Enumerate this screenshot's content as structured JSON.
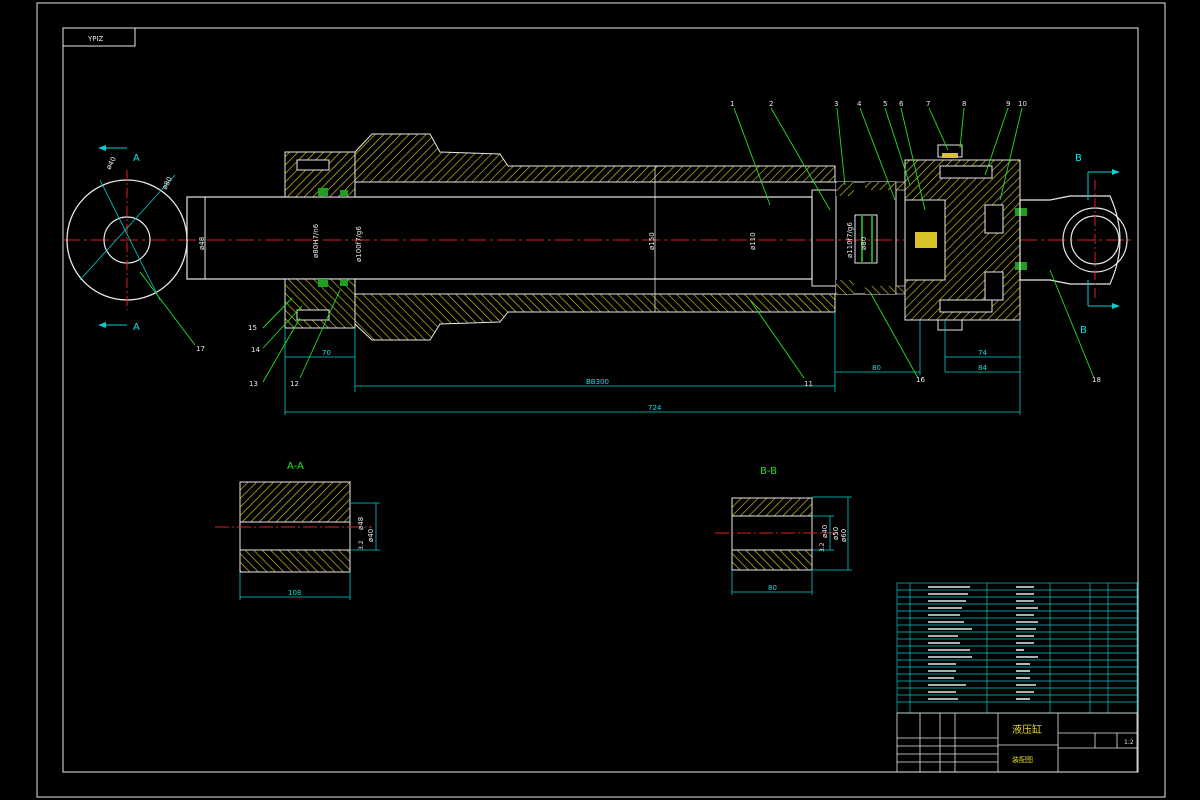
{
  "drawing": {
    "corner_label": "YPIZ",
    "section_aa_title": "A-A",
    "section_bb_title": "B-B",
    "view_letter_a": "A",
    "view_letter_b": "B",
    "part_callouts": [
      "1",
      "2",
      "3",
      "4",
      "5",
      "6",
      "7",
      "8",
      "9",
      "10",
      "11",
      "12",
      "13",
      "14",
      "15",
      "16",
      "17",
      "18"
    ],
    "dimensions": {
      "stroke": "BB300",
      "overall": "724",
      "d70": "70",
      "d80": "80",
      "d74": "74",
      "d84": "84",
      "aa_width": "108",
      "bb_width": "80",
      "dia_bore": "ø150",
      "dia_rod": "ø110",
      "dia_h1": "ø100f7/g6",
      "dia_h2": "ø80H7/n6",
      "dia_h3": "ø110f7/g6",
      "dia_h4": "ø80",
      "dia_h5": "ø80",
      "dia_r": "ø48",
      "dia_ra": "ø40",
      "dia_sa": "ø50",
      "dia_sb": "ø40",
      "dia_sc": "ø60",
      "rough_a": "3.2",
      "rough_b": "3.2"
    },
    "title_block": {
      "title": "液压缸",
      "sheet": "装配图",
      "scale": "1:2"
    },
    "colors": {
      "border": "#e8e8e8",
      "frame": "#00d0d0",
      "section": "#e6d830",
      "centerline": "#e01e1e",
      "dimension": "#00d0d0",
      "leader": "#22e022",
      "callout": "#e8e8e8"
    }
  }
}
